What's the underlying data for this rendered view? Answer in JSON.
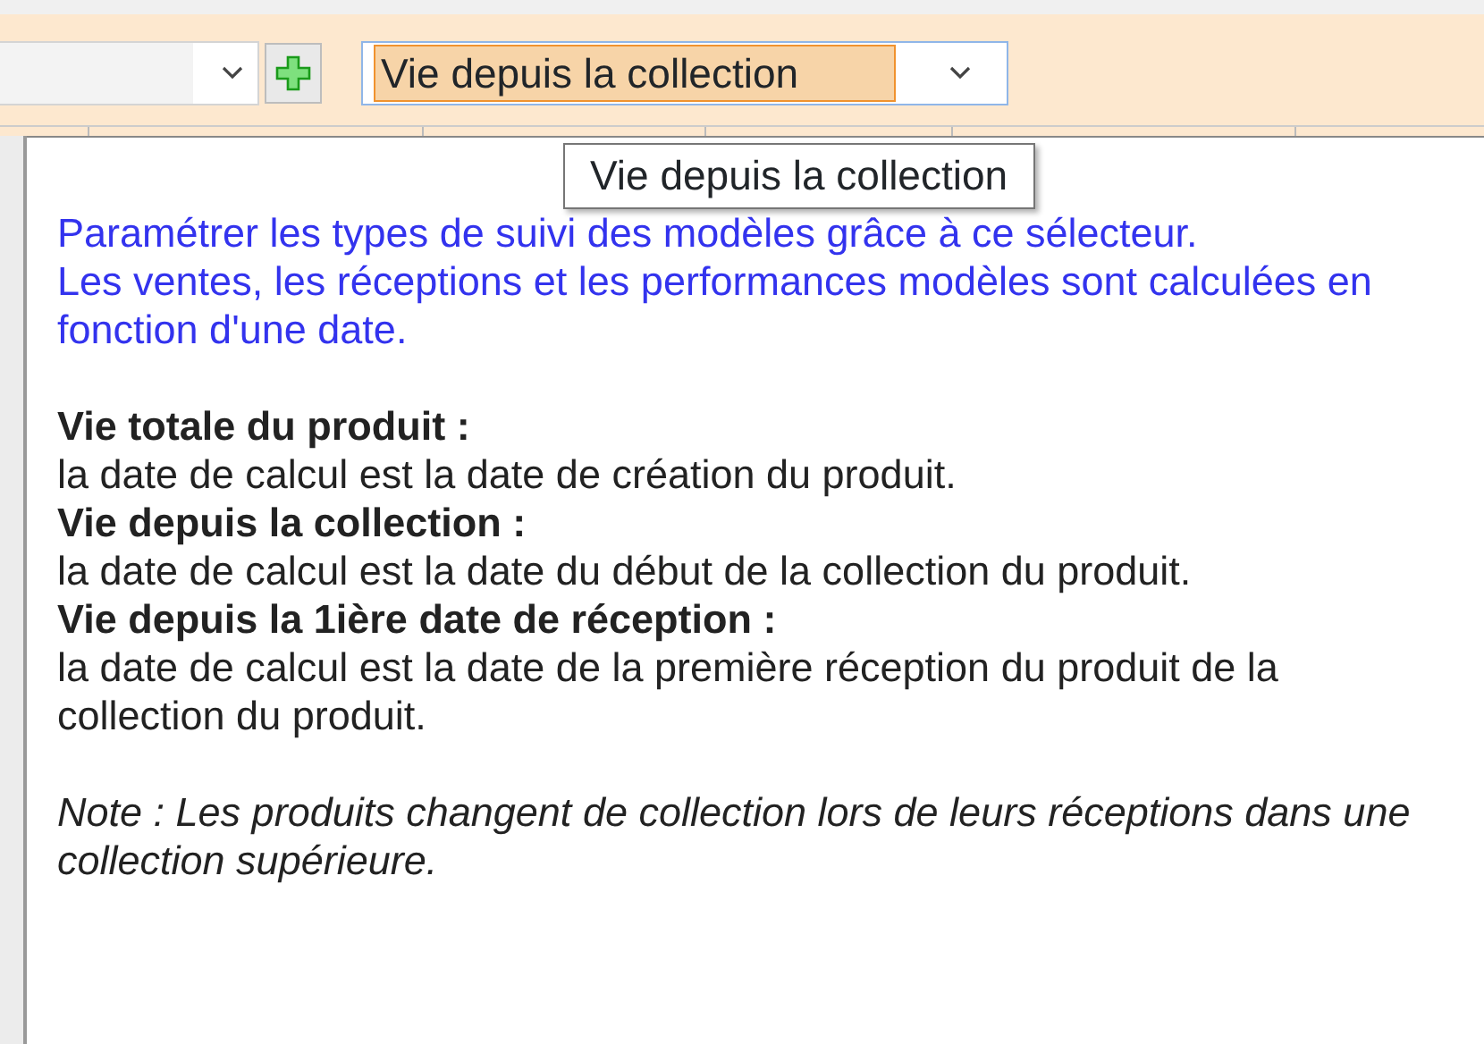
{
  "toolbar": {
    "mode_combo": {
      "value": "Vie depuis la collection",
      "text_selected": true
    }
  },
  "tooltip": {
    "text": "Vie depuis la collection"
  },
  "help": {
    "intro": [
      "Paramétrer les types de suivi des modèles grâce à ce sélecteur.",
      "Les ventes, les réceptions et les performances modèles sont calculées en fonction d'une date."
    ],
    "definitions": [
      {
        "term": "Vie totale du produit :",
        "description": "la date de calcul est la date de création du produit."
      },
      {
        "term": "Vie depuis la collection :",
        "description": "la date de calcul est la date du début de la collection du produit."
      },
      {
        "term": "Vie depuis la 1ière date de réception :",
        "description": "la date de calcul est la date de la première réception du produit de la collection du produit."
      }
    ],
    "note": "Note : Les produits changent de collection lors de leurs réceptions dans une collection supérieure."
  }
}
